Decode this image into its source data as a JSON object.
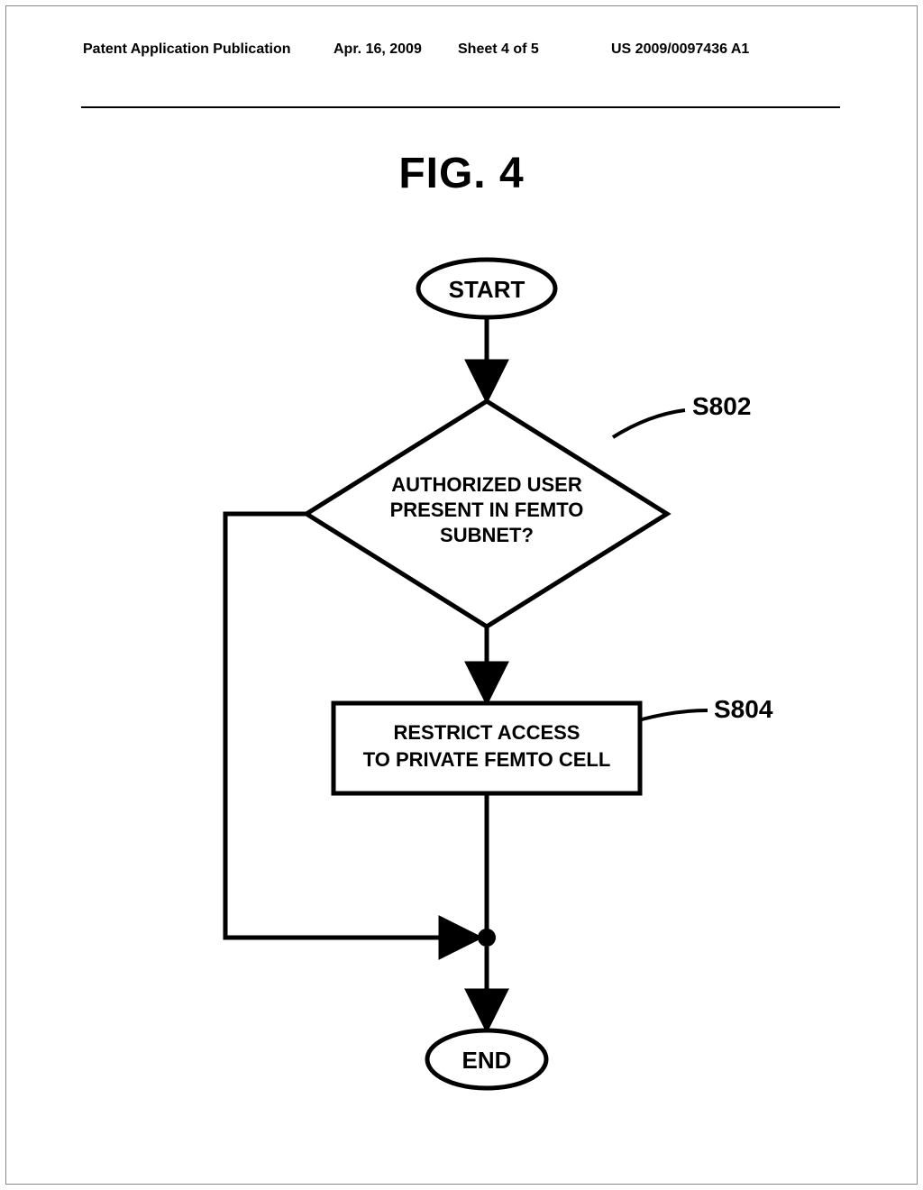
{
  "header": {
    "publication_label": "Patent Application Publication",
    "date": "Apr. 16, 2009",
    "sheet": "Sheet 4 of 5",
    "pub_number": "US 2009/0097436 A1"
  },
  "figure": {
    "title": "FIG. 4",
    "start": "START",
    "decision": {
      "line1": "AUTHORIZED USER",
      "line2": "PRESENT IN FEMTO",
      "line3": "SUBNET?",
      "ref": "S802"
    },
    "process": {
      "line1": "RESTRICT ACCESS",
      "line2": "TO PRIVATE FEMTO CELL",
      "ref": "S804"
    },
    "end": "END"
  }
}
